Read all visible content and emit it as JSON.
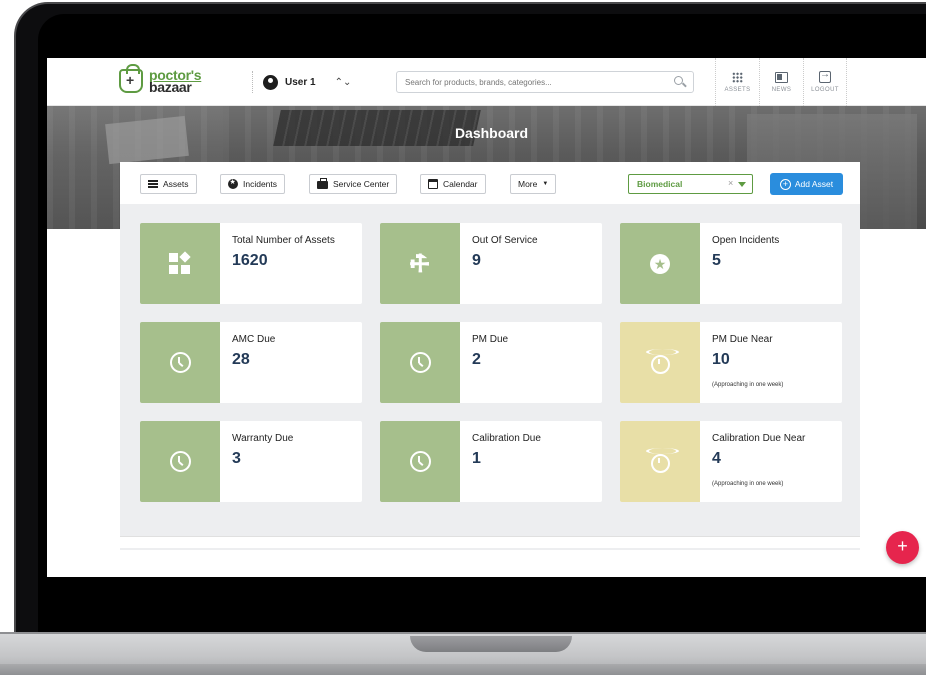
{
  "app": {
    "logo_line1": "poctor's",
    "logo_line2": "bazaar"
  },
  "user": {
    "name": "User 1"
  },
  "search": {
    "placeholder": "Search for products, brands, categories..."
  },
  "nav": [
    {
      "label": "ASSETS",
      "icon": "grid-icon"
    },
    {
      "label": "NEWS",
      "icon": "news-icon"
    },
    {
      "label": "LOGOUT",
      "icon": "logout-icon"
    }
  ],
  "page": {
    "title": "Dashboard"
  },
  "toolbar": {
    "assets": "Assets",
    "incidents": "Incidents",
    "service_center": "Service Center",
    "calendar": "Calendar",
    "more": "More",
    "filter_value": "Biomedical",
    "filter_clear": "×",
    "add_asset": "Add Asset"
  },
  "cards": [
    {
      "title": "Total Number of Assets",
      "value": "1620",
      "icon": "shapes-icon",
      "color": "#a6bf8c"
    },
    {
      "title": "Out Of Service",
      "value": "9",
      "icon": "wrench-icon",
      "color": "#a6bf8c"
    },
    {
      "title": "Open Incidents",
      "value": "5",
      "icon": "star-icon",
      "color": "#a6bf8c"
    },
    {
      "title": "AMC Due",
      "value": "28",
      "icon": "clock-icon",
      "color": "#a6bf8c"
    },
    {
      "title": "PM Due",
      "value": "2",
      "icon": "clock-icon",
      "color": "#a6bf8c"
    },
    {
      "title": "PM Due Near",
      "value": "10",
      "note": "(Approaching in one week)",
      "icon": "alarm-clock-icon",
      "color": "#e8dfa7"
    },
    {
      "title": "Warranty Due",
      "value": "3",
      "icon": "clock-icon",
      "color": "#a6bf8c"
    },
    {
      "title": "Calibration Due",
      "value": "1",
      "icon": "clock-icon",
      "color": "#a6bf8c"
    },
    {
      "title": "Calibration Due Near",
      "value": "4",
      "note": "(Approaching in one week)",
      "icon": "alarm-clock-icon",
      "color": "#e8dfa7"
    }
  ],
  "fab": {
    "label": "+"
  },
  "colors": {
    "accent_green": "#5e9b42",
    "primary_blue": "#2a8ddd",
    "fab_red": "#e6254d",
    "card_green": "#a6bf8c",
    "card_yellow": "#e8dfa7",
    "value_navy": "#233a57"
  }
}
